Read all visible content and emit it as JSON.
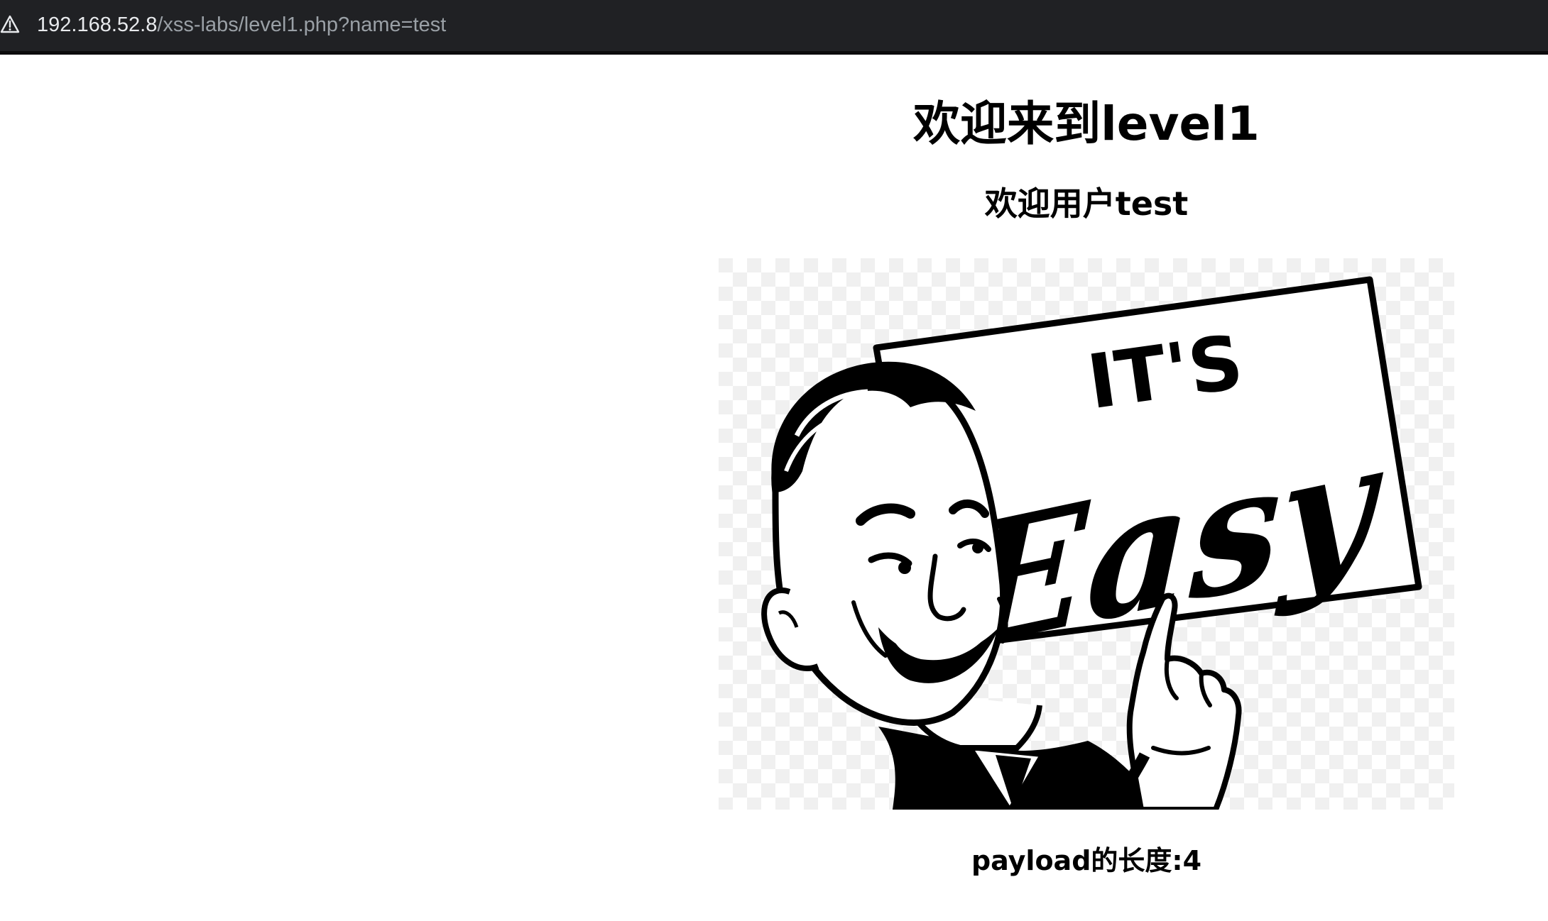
{
  "browser": {
    "url_host": "192.168.52.8",
    "url_path": "/xss-labs/level1.php?name=test",
    "security_icon": "warning-triangle-icon",
    "colors": {
      "bar_background": "#202124",
      "host_text": "#e8eaed",
      "path_text": "#9aa0a6"
    }
  },
  "page": {
    "title": "欢迎来到level1",
    "welcome_text": "欢迎用户test",
    "image": {
      "sign_line1": "IT'S",
      "sign_line2": "Easy"
    },
    "payload_length_text": "payload的长度:4"
  }
}
